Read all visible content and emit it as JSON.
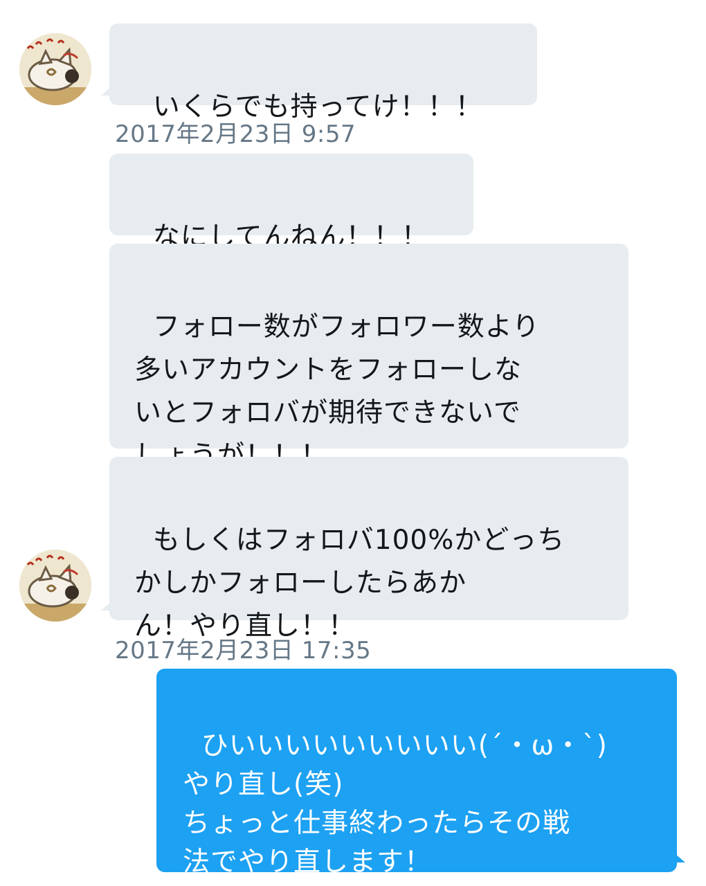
{
  "messages": {
    "m1": "いくらでも持ってけ！！！",
    "ts1": "2017年2月23日 9:57",
    "m2": "なにしてんねん！！！",
    "m3": "フォロー数がフォロワー数より\n多いアカウントをフォローしな\nいとフォロバが期待できないで\nしょうが！！！",
    "m4": "もしくはフォロバ100%かどっち\nかしかフォローしたらあか\nん！やり直し！！",
    "ts2": "2017年2月23日 17:35",
    "m5": "ひいいいいいいいいい(´・ω・`)\nやり直し(笑)\nちょっと仕事終わったらその戦\n法でやり直します！"
  },
  "colors": {
    "received_bubble": "#e6ecf0",
    "sent_bubble": "#1da1f2",
    "timestamp": "#657786"
  }
}
